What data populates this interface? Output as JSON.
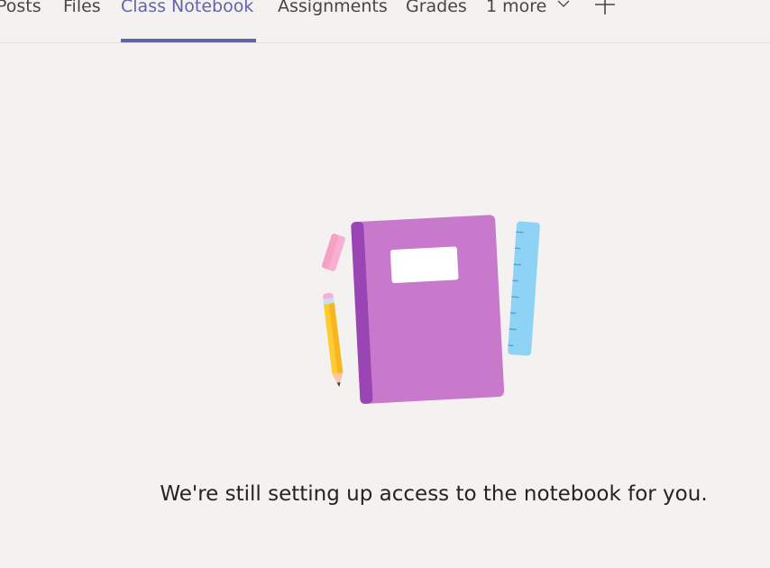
{
  "tabs": [
    {
      "label": "Posts",
      "active": false
    },
    {
      "label": "Files",
      "active": false
    },
    {
      "label": "Class Notebook",
      "active": true
    },
    {
      "label": "Assignments",
      "active": false
    },
    {
      "label": "Grades",
      "active": false
    },
    {
      "label": "1 more",
      "active": false
    }
  ],
  "icons": {
    "more": "chevron-down-icon",
    "add": "plus-icon",
    "illustration": "notebook-illustration"
  },
  "colors": {
    "accent": "#6264a7",
    "background": "#f3f2f1",
    "notebook": "#c979cc",
    "notebook_spine": "#9b44b4",
    "ruler": "#8fd3f4",
    "pencil": "#ffcb2e",
    "eraser": "#f7b0d2"
  },
  "main": {
    "message": "We're still setting up access to the notebook for you."
  }
}
